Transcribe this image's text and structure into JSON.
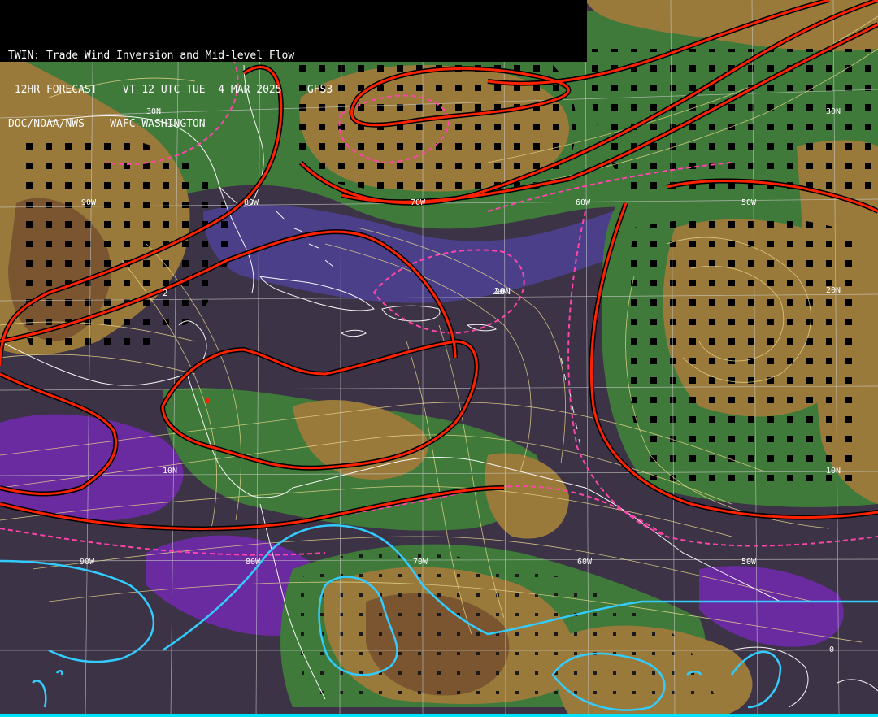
{
  "header": {
    "line1": "TWIN: Trade Wind Inversion and Mid-level Flow",
    "line2": " 12HR FORECAST    VT 12 UTC TUE  4 MAR 2025    GFS3",
    "line3": "DOC/NOAA/NWS    WAFC-WASHINGTON"
  },
  "graticule": {
    "lon_labels_top": [
      "90W",
      "80W",
      "70W",
      "60W",
      "50W"
    ],
    "lat_labels_right": [
      "30N",
      "20N",
      "10N",
      "0"
    ],
    "lon_labels_bottom": [
      "90W",
      "80W",
      "70W",
      "60W",
      "50W"
    ],
    "lat_labels_left": [
      "30N",
      "20N",
      "10N"
    ]
  },
  "contour_labels": [
    "2",
    "20N"
  ],
  "colors": {
    "inversion_low": "#9a7a3a",
    "inversion_mid": "#3f7a3a",
    "inversion_high": "#4a3a6a",
    "deep_purple": "#6a2aa0",
    "slate": "#3c3346",
    "contour_red": "#ff2200",
    "contour_dash": "#ff44aa",
    "contour_cyan": "#33ccff",
    "streamline": "#e8d78c",
    "coast": "#ffffff"
  }
}
